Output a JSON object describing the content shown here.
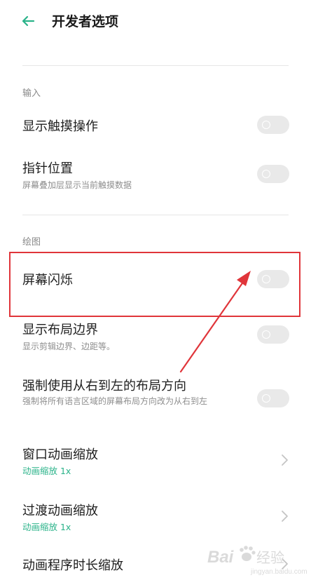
{
  "header": {
    "title": "开发者选项",
    "back_icon": "arrow-left-icon",
    "accent_color": "#2bb38a"
  },
  "sections": [
    {
      "label": "输入"
    },
    {
      "label": "绘图"
    }
  ],
  "rows": [
    {
      "title": "显示触摸操作",
      "control": "toggle",
      "on": false
    },
    {
      "title": "指针位置",
      "subtitle": "屏幕叠加层显示当前触摸数据",
      "control": "toggle",
      "on": false
    },
    {
      "title": "屏幕闪烁",
      "control": "toggle",
      "on": false,
      "highlighted": true
    },
    {
      "title": "显示布局边界",
      "subtitle": "显示剪辑边界、边距等。",
      "control": "toggle",
      "on": false
    },
    {
      "title": "强制使用从右到左的布局方向",
      "subtitle": "强制将所有语言区域的屏幕布局方向改为从右到左",
      "control": "toggle",
      "on": false
    },
    {
      "title": "窗口动画缩放",
      "subtitle": "动画缩放 1x",
      "control": "chevron"
    },
    {
      "title": "过渡动画缩放",
      "subtitle": "动画缩放 1x",
      "control": "chevron"
    },
    {
      "title": "动画程序时长缩放",
      "control": "chevron"
    }
  ],
  "annotation": {
    "color": "#e0353a"
  },
  "watermark": {
    "text": "Bai",
    "suffix": "经验",
    "domain": "jingyan.baidu.com"
  }
}
